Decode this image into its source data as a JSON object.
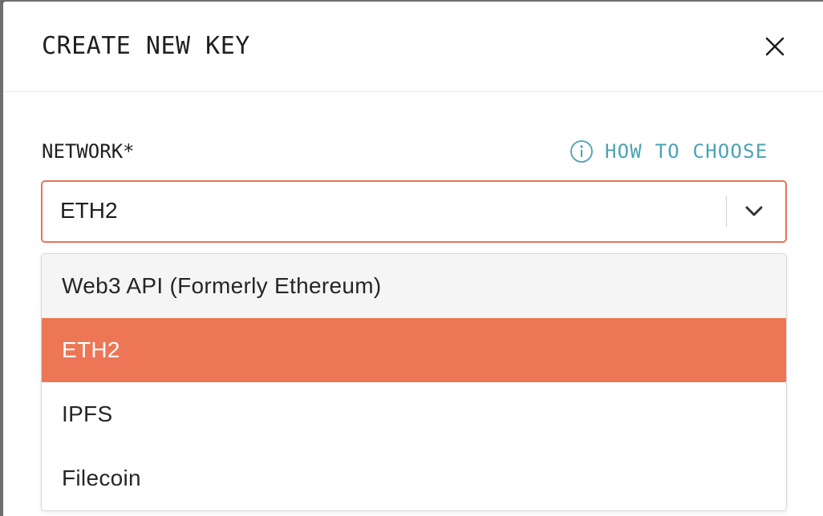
{
  "modal": {
    "title": "CREATE NEW KEY"
  },
  "form": {
    "network_label": "NETWORK*",
    "help_link": "HOW TO CHOOSE",
    "selected_value": "ETH2"
  },
  "dropdown": {
    "options": [
      {
        "label": "Web3 API (Formerly Ethereum)",
        "state": "hover"
      },
      {
        "label": "ETH2",
        "state": "selected"
      },
      {
        "label": "IPFS",
        "state": "normal"
      },
      {
        "label": "Filecoin",
        "state": "normal"
      }
    ]
  },
  "colors": {
    "accent": "#ec7655",
    "link": "#4aa3b4",
    "text": "#1f1f1f",
    "hover_bg": "#f5f5f5",
    "backdrop": "#6e6e6e"
  },
  "icons": {
    "close": "close-icon",
    "info": "info-icon",
    "chevron": "chevron-down-icon"
  }
}
